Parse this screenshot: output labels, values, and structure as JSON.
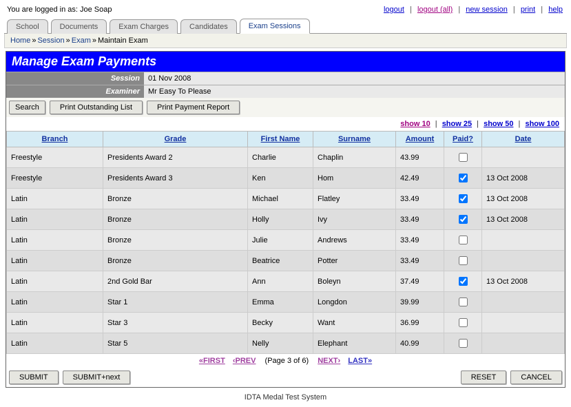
{
  "header": {
    "logged_in_prefix": "You are logged in as: ",
    "user": "Joe Soap",
    "links": {
      "logout": "logout",
      "logout_all": "logout (all)",
      "new_session": "new session",
      "print": "print",
      "help": "help"
    }
  },
  "tabs": [
    {
      "label": "School"
    },
    {
      "label": "Documents"
    },
    {
      "label": "Exam Charges"
    },
    {
      "label": "Candidates"
    },
    {
      "label": "Exam Sessions",
      "active": true
    }
  ],
  "breadcrumb": {
    "items": [
      "Home",
      "Session",
      "Exam",
      "Maintain Exam"
    ],
    "sep": "»"
  },
  "page": {
    "title": "Manage Exam Payments",
    "meta": {
      "session_label": "Session",
      "session_value": "01 Nov 2008",
      "examiner_label": "Examiner",
      "examiner_value": "Mr Easy To Please"
    },
    "toolbar": {
      "search": "Search",
      "print_outstanding": "Print Outstanding List",
      "print_payment": "Print Payment Report"
    },
    "page_size": {
      "s10": "show 10",
      "s25": "show 25",
      "s50": "show 50",
      "s100": "show 100"
    },
    "columns": {
      "branch": "Branch",
      "grade": "Grade",
      "first": "First Name",
      "surname": "Surname",
      "amount": "Amount",
      "paid": "Paid?",
      "date": "Date"
    },
    "rows": [
      {
        "branch": "Freestyle",
        "grade": "Presidents Award 2",
        "first": "Charlie",
        "surname": "Chaplin",
        "amount": "43.99",
        "paid": false,
        "date": ""
      },
      {
        "branch": "Freestyle",
        "grade": "Presidents Award 3",
        "first": "Ken",
        "surname": "Hom",
        "amount": "42.49",
        "paid": true,
        "date": "13 Oct 2008"
      },
      {
        "branch": "Latin",
        "grade": "Bronze",
        "first": "Michael",
        "surname": "Flatley",
        "amount": "33.49",
        "paid": true,
        "date": "13 Oct 2008"
      },
      {
        "branch": "Latin",
        "grade": "Bronze",
        "first": "Holly",
        "surname": "Ivy",
        "amount": "33.49",
        "paid": true,
        "date": "13 Oct 2008"
      },
      {
        "branch": "Latin",
        "grade": "Bronze",
        "first": "Julie",
        "surname": "Andrews",
        "amount": "33.49",
        "paid": false,
        "date": ""
      },
      {
        "branch": "Latin",
        "grade": "Bronze",
        "first": "Beatrice",
        "surname": "Potter",
        "amount": "33.49",
        "paid": false,
        "date": ""
      },
      {
        "branch": "Latin",
        "grade": "2nd Gold Bar",
        "first": "Ann",
        "surname": "Boleyn",
        "amount": "37.49",
        "paid": true,
        "date": "13 Oct 2008"
      },
      {
        "branch": "Latin",
        "grade": "Star 1",
        "first": "Emma",
        "surname": "Longdon",
        "amount": "39.99",
        "paid": false,
        "date": ""
      },
      {
        "branch": "Latin",
        "grade": "Star 3",
        "first": "Becky",
        "surname": "Want",
        "amount": "36.99",
        "paid": false,
        "date": ""
      },
      {
        "branch": "Latin",
        "grade": "Star 5",
        "first": "Nelly",
        "surname": "Elephant",
        "amount": "40.99",
        "paid": false,
        "date": ""
      }
    ],
    "pager": {
      "first": "«FIRST",
      "prev": "‹PREV",
      "page_of": "(Page 3 of 6)",
      "next": "NEXT›",
      "last": "LAST»"
    },
    "buttons": {
      "submit": "SUBMIT",
      "submit_next": "SUBMIT+next",
      "reset": "RESET",
      "cancel": "CANCEL"
    }
  },
  "footer": "IDTA Medal Test System"
}
